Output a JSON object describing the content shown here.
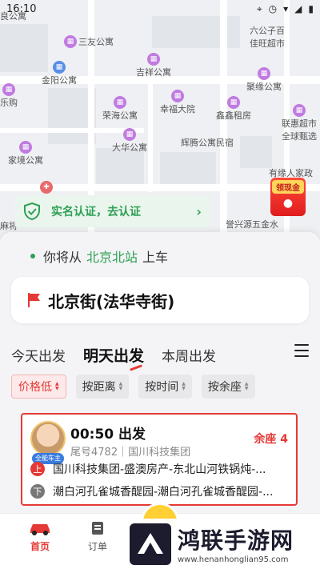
{
  "status_bar": {
    "time": "16:10"
  },
  "map": {
    "labels": [
      "良公寓",
      "六公子百",
      "佳旺超市",
      "三友公寓",
      "金阳公寓",
      "吉祥公寓",
      "聚缘公寓",
      "乐购",
      "荣海公寓",
      "幸福大院",
      "鑫鑫租房",
      "联惠超市",
      "全球甄选",
      "大华公寓",
      "辉腾公寓民宿",
      "家境公寓",
      "有缘人家政",
      "誉兴源五金水",
      "麻将"
    ],
    "verify_text": "实名认证，去认证",
    "coupon_label": "领现金"
  },
  "boarding": {
    "prefix": "你将从",
    "station": "北京北站",
    "suffix": "上车"
  },
  "destination": "北京街(法华寺街)",
  "tabs": [
    {
      "label": "今天出发"
    },
    {
      "label": "明天出发"
    },
    {
      "label": "本周出发"
    }
  ],
  "filters": [
    {
      "label": "价格低"
    },
    {
      "label": "按距离"
    },
    {
      "label": "按时间"
    },
    {
      "label": "按余座"
    }
  ],
  "trip": {
    "owner_badge": "全能车主",
    "depart": "00:50 出发",
    "plate": "尾号4782｜国川科技集团",
    "seats": "余座 4",
    "up_badge": "上",
    "down_badge": "下",
    "pickup": "国川科技集团-盛澳房产-东北山河铁锅炖-...",
    "dropoff": "潮白河孔雀城香醍园-潮白河孔雀城香醍园-..."
  },
  "nav": {
    "home": "首页",
    "orders": "订单"
  },
  "watermark": {
    "title": "鸿联手游网",
    "url": "www.henanhonglian95.com"
  }
}
